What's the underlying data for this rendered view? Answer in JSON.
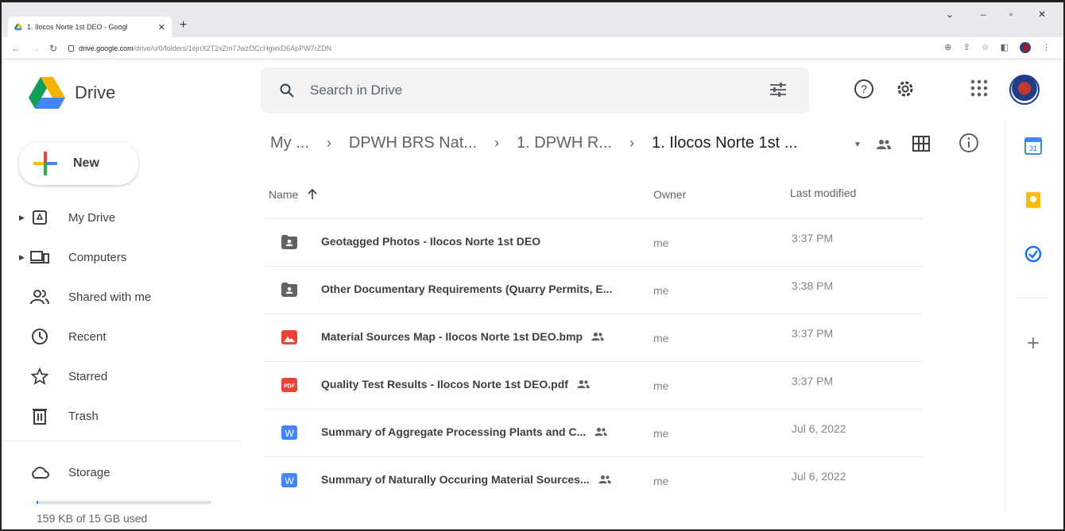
{
  "browser": {
    "tab_title": "1. Ilocos Norte 1st DEO - Googl",
    "url_host": "drive.google.com",
    "url_path": "/drive/u/0/folders/1ejnX2T2xZm7JwzOCcHgwxD6ApPW7rZDN"
  },
  "app": {
    "name": "Drive"
  },
  "search": {
    "placeholder": "Search in Drive"
  },
  "sidebar": {
    "new_label": "New",
    "items": [
      {
        "label": "My Drive",
        "icon": "my-drive-icon"
      },
      {
        "label": "Computers",
        "icon": "computers-icon"
      },
      {
        "label": "Shared with me",
        "icon": "shared-icon"
      },
      {
        "label": "Recent",
        "icon": "clock-icon"
      },
      {
        "label": "Starred",
        "icon": "star-icon"
      },
      {
        "label": "Trash",
        "icon": "trash-icon"
      }
    ],
    "storage_label": "Storage",
    "storage_used": "159 KB of 15 GB used",
    "storage_fraction": 1e-05
  },
  "breadcrumb": [
    "My ...",
    "DPWH BRS Nat...",
    "1. DPWH R...",
    "1. Ilocos Norte 1st ..."
  ],
  "table": {
    "headers": {
      "name": "Name",
      "owner": "Owner",
      "modified": "Last modified"
    },
    "rows": [
      {
        "name": "Geotagged Photos - Ilocos Norte 1st DEO",
        "type": "shared-folder",
        "shared": false,
        "owner": "me",
        "modified": "3:37 PM"
      },
      {
        "name": "Other Documentary Requirements (Quarry Permits, E...",
        "type": "shared-folder",
        "shared": false,
        "owner": "me",
        "modified": "3:38 PM"
      },
      {
        "name": "Material Sources Map - Ilocos Norte 1st DEO.bmp",
        "type": "image",
        "shared": true,
        "owner": "me",
        "modified": "3:37 PM"
      },
      {
        "name": "Quality Test Results - Ilocos Norte 1st DEO.pdf",
        "type": "pdf",
        "shared": true,
        "owner": "me",
        "modified": "3:37 PM"
      },
      {
        "name": "Summary of Aggregate Processing Plants and C...",
        "type": "word",
        "shared": true,
        "owner": "me",
        "modified": "Jul 6, 2022"
      },
      {
        "name": "Summary of Naturally Occuring Material Sources...",
        "type": "word",
        "shared": true,
        "owner": "me",
        "modified": "Jul 6, 2022"
      }
    ]
  },
  "colors": {
    "drive_blue": "#4285f4",
    "drive_green": "#0f9d58",
    "drive_yellow": "#f4b400",
    "drive_red": "#db4437",
    "folder": "#5f6368",
    "pdf_red": "#ea4335",
    "word_blue": "#4285f4"
  }
}
